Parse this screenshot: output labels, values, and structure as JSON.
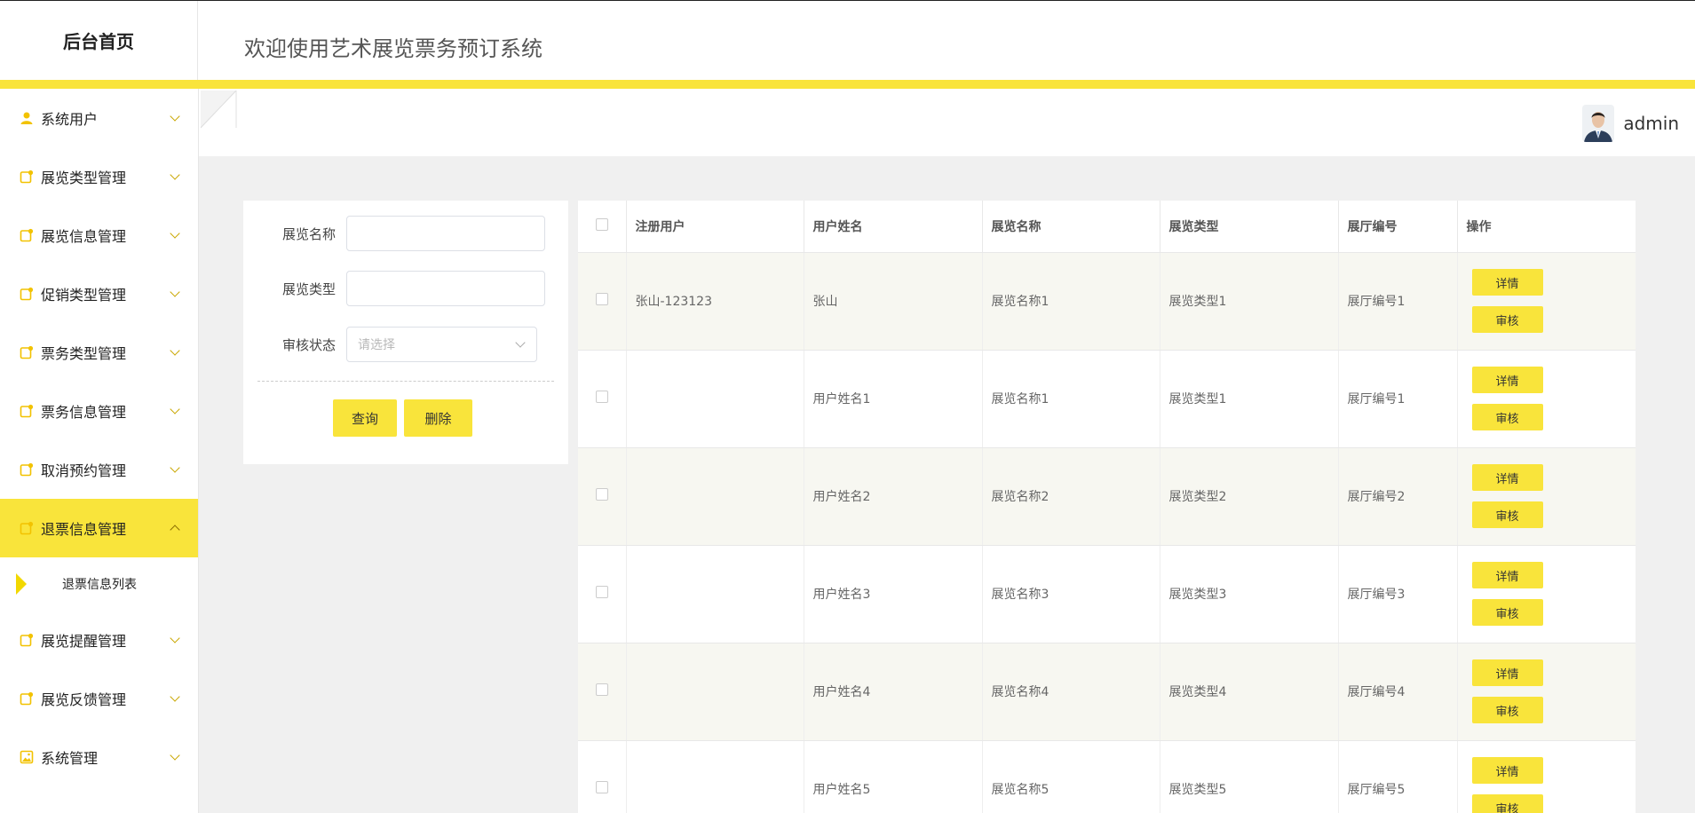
{
  "header": {
    "brand": "后台首页",
    "welcome": "欢迎使用艺术展览票务预订系统"
  },
  "user": {
    "name": "admin"
  },
  "sidebar": {
    "items": [
      {
        "label": "系统用户",
        "icon": "user-icon"
      },
      {
        "label": "展览类型管理",
        "icon": "note-icon"
      },
      {
        "label": "展览信息管理",
        "icon": "note-icon"
      },
      {
        "label": "促销类型管理",
        "icon": "note-icon"
      },
      {
        "label": "票务类型管理",
        "icon": "note-icon"
      },
      {
        "label": "票务信息管理",
        "icon": "note-icon"
      },
      {
        "label": "取消预约管理",
        "icon": "note-icon"
      },
      {
        "label": "退票信息管理",
        "icon": "note-icon",
        "active": true
      },
      {
        "label": "展览提醒管理",
        "icon": "note-icon"
      },
      {
        "label": "展览反馈管理",
        "icon": "note-icon"
      },
      {
        "label": "系统管理",
        "icon": "image-icon"
      }
    ],
    "sub_item": "退票信息列表"
  },
  "search": {
    "name_label": "展览名称",
    "name_value": "",
    "type_label": "展览类型",
    "type_value": "",
    "status_label": "审核状态",
    "status_placeholder": "请选择",
    "query_button": "查询",
    "delete_button": "删除"
  },
  "table": {
    "columns": [
      "注册用户",
      "用户姓名",
      "展览名称",
      "展览类型",
      "展厅编号",
      "操作"
    ],
    "rows": [
      [
        "张山-123123",
        "张山",
        "展览名称1",
        "展览类型1",
        "展厅编号1"
      ],
      [
        "",
        "用户姓名1",
        "展览名称1",
        "展览类型1",
        "展厅编号1"
      ],
      [
        "",
        "用户姓名2",
        "展览名称2",
        "展览类型2",
        "展厅编号2"
      ],
      [
        "",
        "用户姓名3",
        "展览名称3",
        "展览类型3",
        "展厅编号3"
      ],
      [
        "",
        "用户姓名4",
        "展览名称4",
        "展览类型4",
        "展厅编号4"
      ],
      [
        "",
        "用户姓名5",
        "展览名称5",
        "展览类型5",
        "展厅编号5"
      ]
    ],
    "detail_label": "详情",
    "review_label": "审核"
  },
  "colors": {
    "accent": "#f9e43b",
    "icon": "#f2c200"
  }
}
